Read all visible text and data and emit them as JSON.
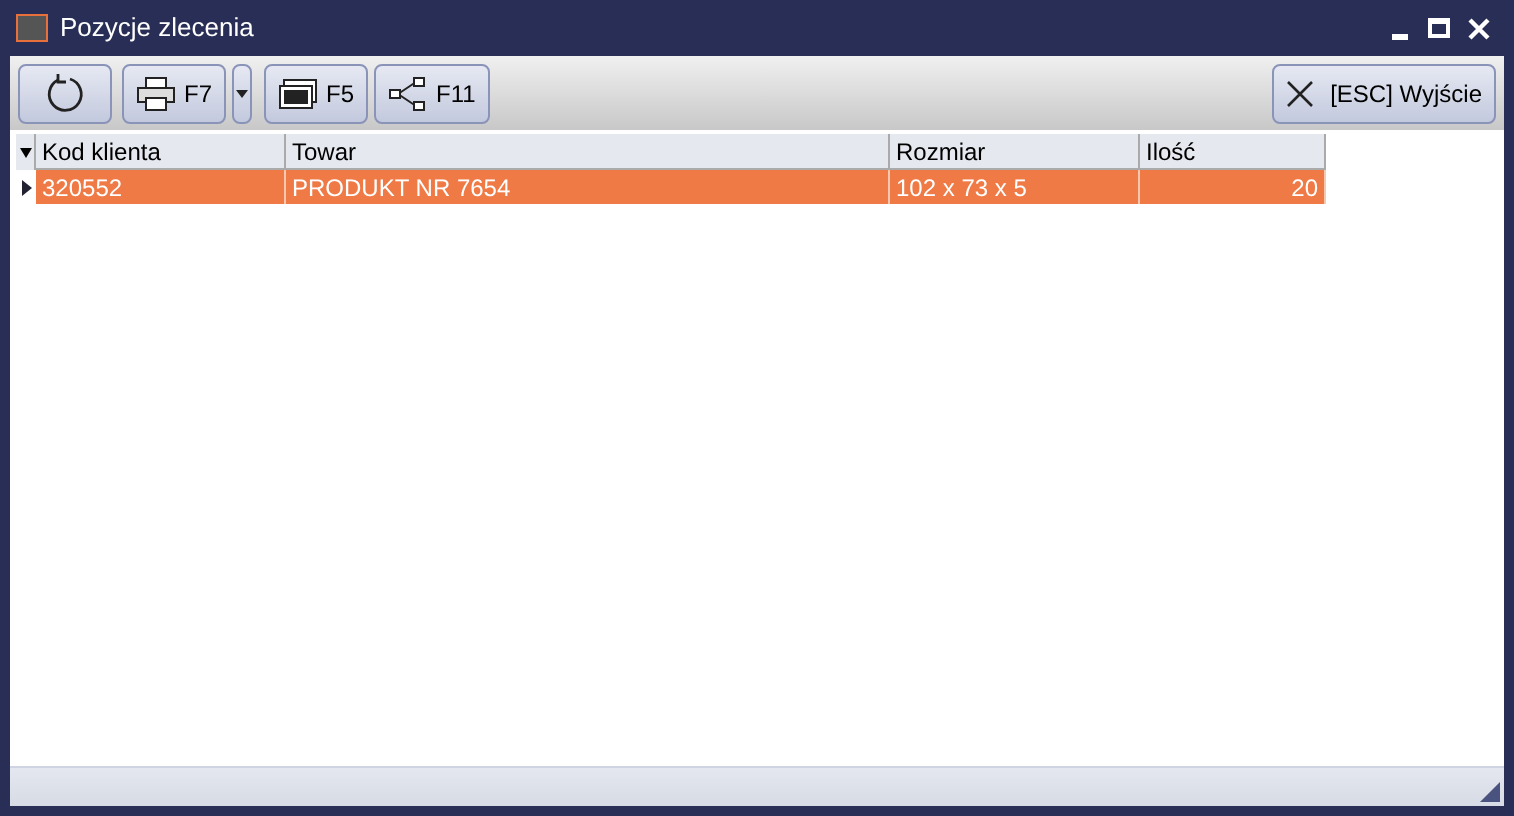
{
  "window": {
    "title": "Pozycje zlecenia"
  },
  "toolbar": [
    {
      "kind": "refresh"
    },
    {
      "kind": "print",
      "label": "F7"
    },
    {
      "kind": "dropdown"
    },
    {
      "kind": "screen",
      "label": "F5"
    },
    {
      "kind": "share",
      "label": "F11"
    }
  ],
  "exit_button": {
    "label": "[ESC] Wyjście"
  },
  "table": {
    "columns": [
      {
        "label": "Kod klienta",
        "numeric": false
      },
      {
        "label": "Towar",
        "numeric": false
      },
      {
        "label": "Rozmiar",
        "numeric": false
      },
      {
        "label": "Ilość",
        "numeric": true
      }
    ],
    "rows": [
      {
        "selected": true,
        "cells": [
          "320552",
          "PRODUKT NR 7654",
          "102 x 73 x 5",
          "20"
        ]
      }
    ]
  }
}
